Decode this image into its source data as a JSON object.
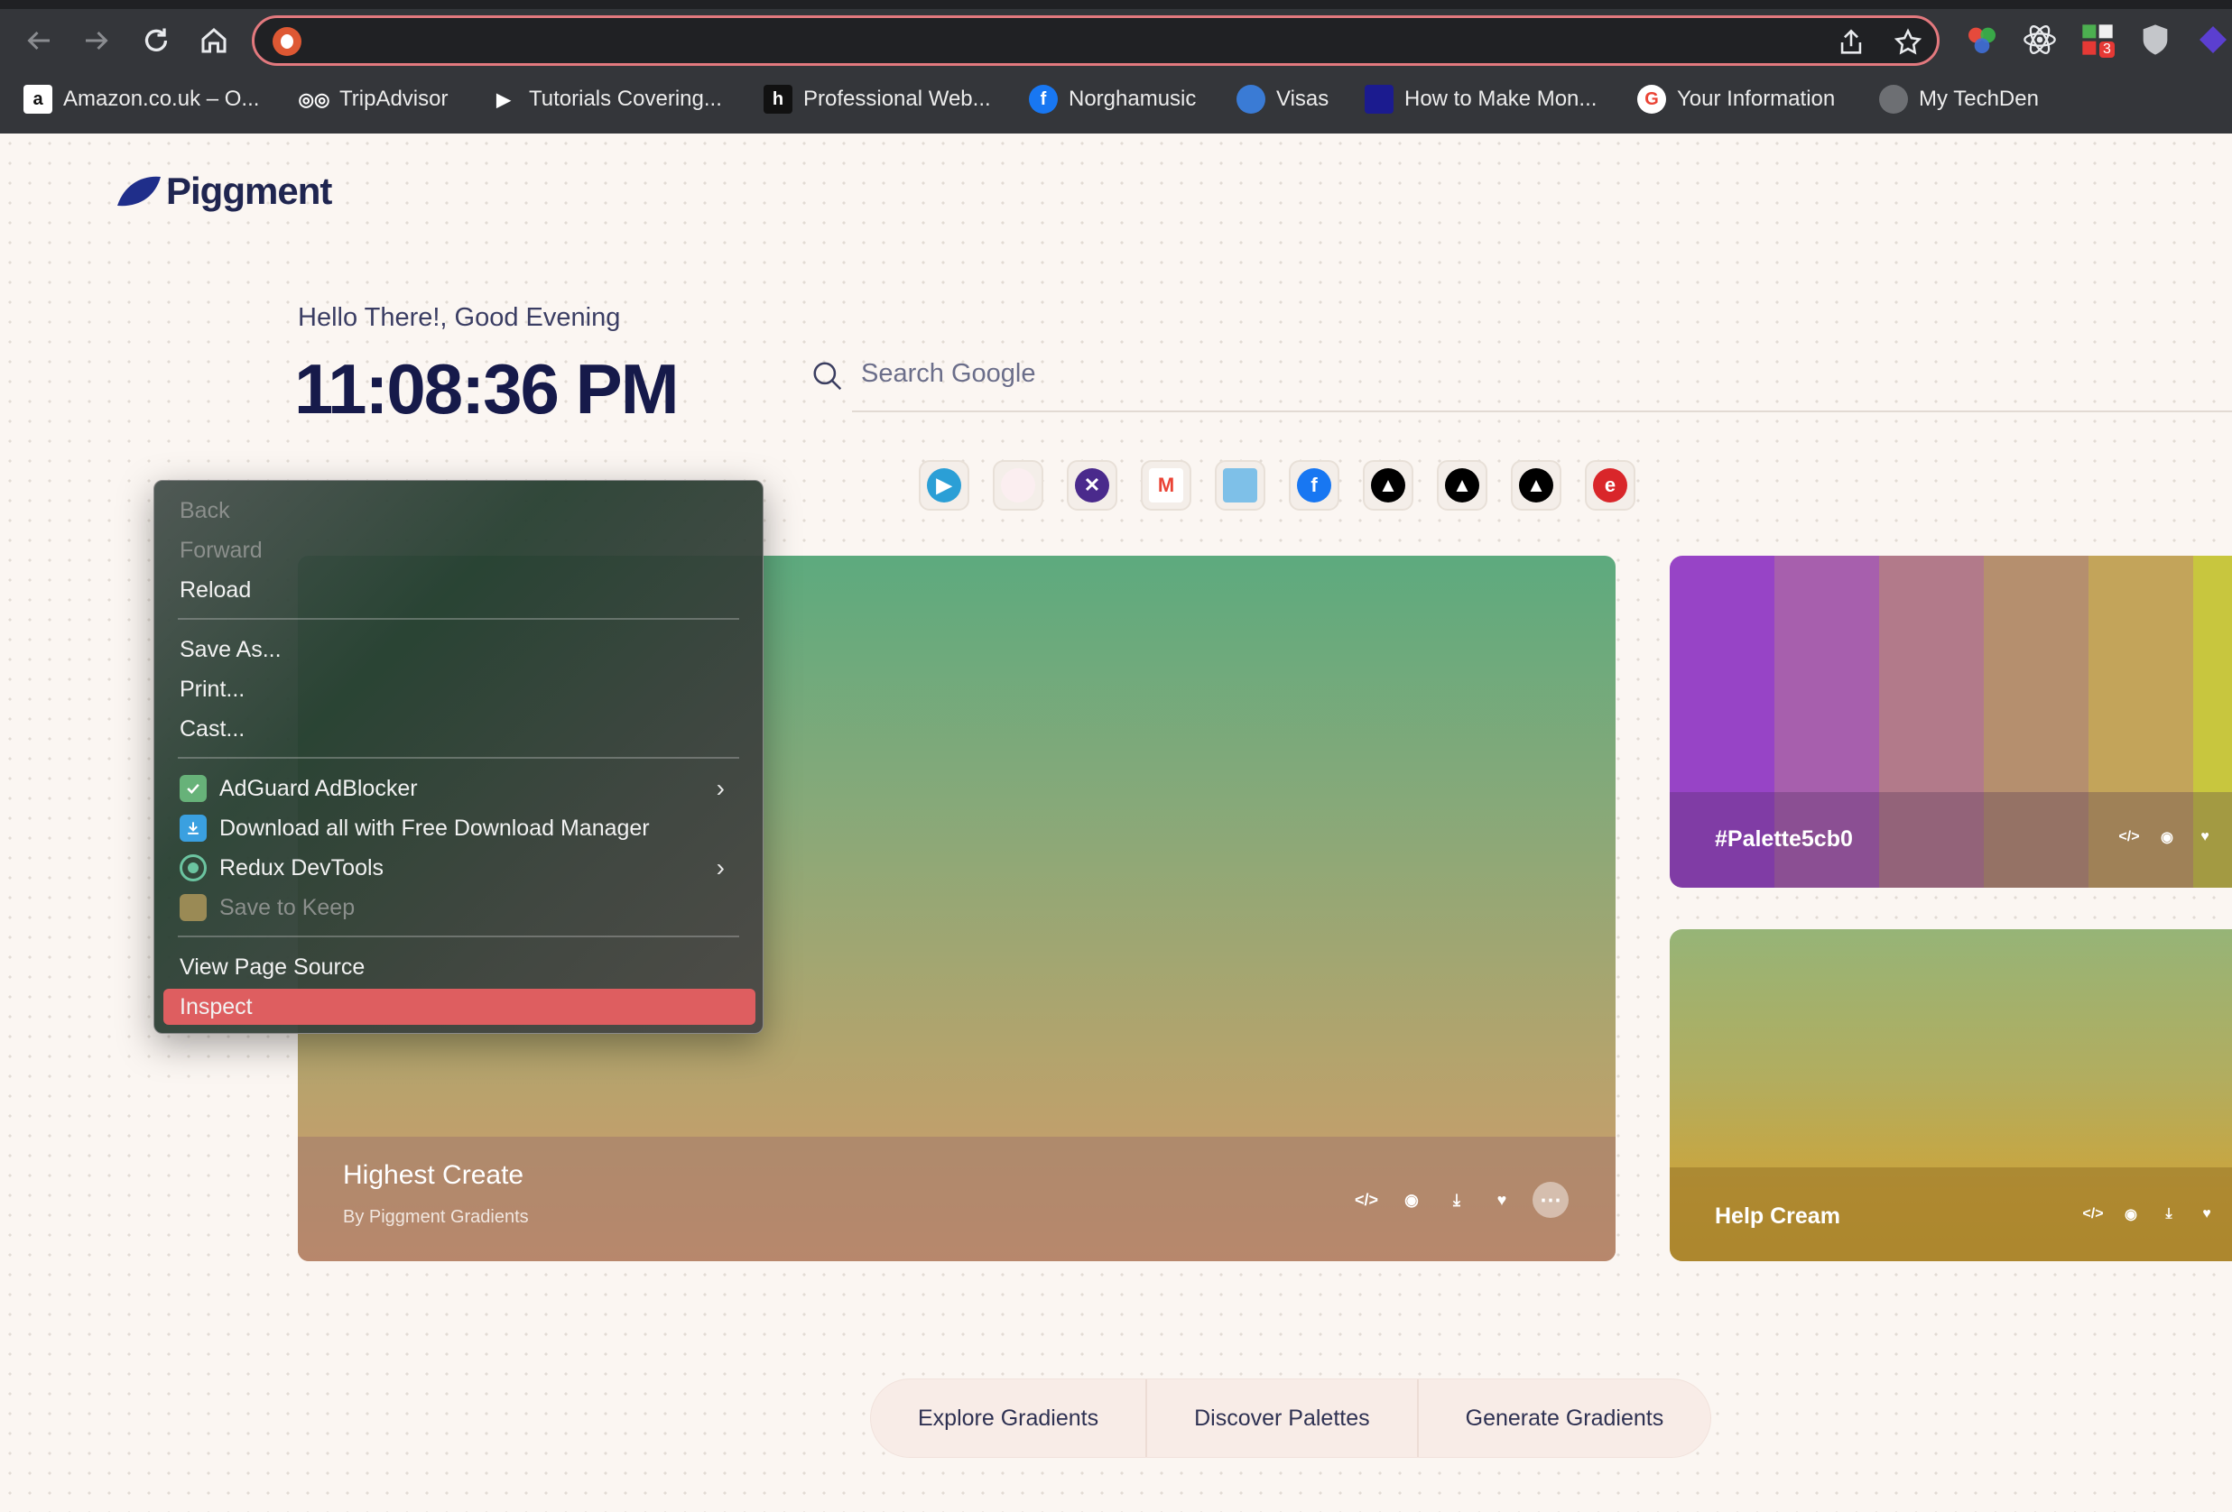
{
  "browser": {
    "address": "",
    "bookmarks": [
      {
        "label": "Amazon.co.uk – O...",
        "icon": "amazon-icon"
      },
      {
        "label": "TripAdvisor",
        "icon": "tripadvisor-icon"
      },
      {
        "label": "Tutorials Covering...",
        "icon": "play-icon"
      },
      {
        "label": "Professional Web...",
        "icon": "h-icon"
      },
      {
        "label": "Norghamusic",
        "icon": "facebook-icon"
      },
      {
        "label": "Visas",
        "icon": "globe-icon"
      },
      {
        "label": "How to Make Mon...",
        "icon": "site-icon"
      },
      {
        "label": "Your Information",
        "icon": "google-icon"
      },
      {
        "label": "My TechDen",
        "icon": "globe-icon"
      }
    ],
    "extension_badge": "3"
  },
  "page": {
    "logo_text": "Piggment",
    "greeting": "Hello There!, Good Evening",
    "clock": "11:08:36 PM",
    "search_placeholder": "Search Google",
    "shortcuts": [
      "play",
      "blank",
      "x",
      "gmail",
      "book",
      "facebook",
      "vercel",
      "vercel",
      "vercel",
      "e"
    ],
    "main_card": {
      "title": "Highest Create",
      "subtitle": "By Piggment Gradients"
    },
    "palette_card": {
      "name": "#Palette5cb0",
      "colors": [
        "#9744c6",
        "#a75fad",
        "#b27a8a",
        "#b58f6e",
        "#c3a45a",
        "#c8c63e"
      ]
    },
    "help_card": {
      "name": "Help Cream"
    },
    "bottom_nav": [
      "Explore Gradients",
      "Discover Palettes",
      "Generate Gradients"
    ]
  },
  "context_menu": {
    "back": "Back",
    "forward": "Forward",
    "reload": "Reload",
    "save_as": "Save As...",
    "print": "Print...",
    "cast": "Cast...",
    "adguard": "AdGuard AdBlocker",
    "download_all": "Download all with Free Download Manager",
    "redux": "Redux DevTools",
    "save_keep": "Save to Keep",
    "view_source": "View Page Source",
    "inspect": "Inspect"
  },
  "colors": {
    "accent": "#de5e60",
    "brand": "#1f2550",
    "omnibox_border": "#e3797e"
  }
}
